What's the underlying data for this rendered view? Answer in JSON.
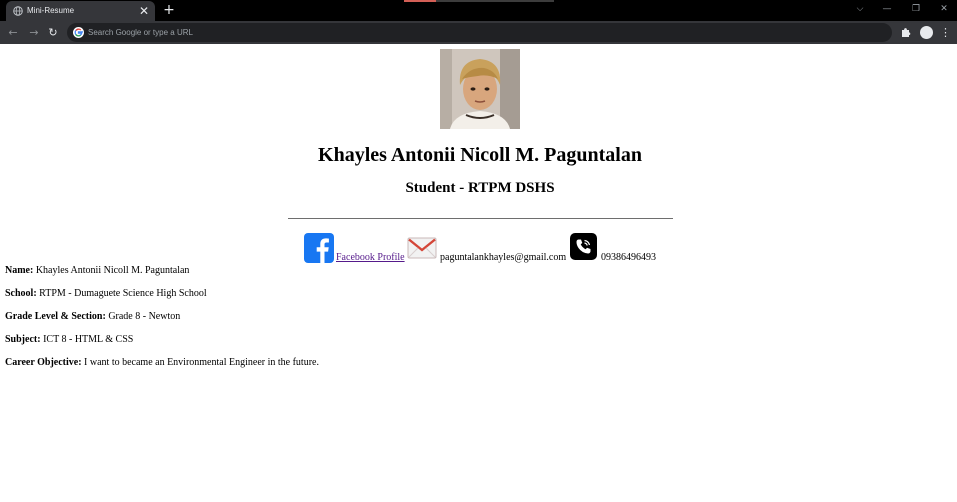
{
  "browser": {
    "tab_title": "Mini-Resume",
    "tab_close": "✕",
    "new_tab": "+",
    "omnibox_placeholder": "Search Google or type a URL",
    "window_controls": {
      "chevron": "⌵",
      "minimize": "—",
      "restore": "❐",
      "close": "✕"
    },
    "nav": {
      "back": "←",
      "forward": "→",
      "reload": "↻"
    },
    "menu": "⋮",
    "accent_color": "#d35f56"
  },
  "resume": {
    "name": "Khayles Antonii Nicoll M. Paguntalan",
    "role": "Student - RTPM DSHS",
    "contacts": {
      "facebook_label": "Facebook Profile",
      "email": "paguntalankhayles@gmail.com",
      "phone": "09386496493",
      "facebook_color": "#1877f2"
    },
    "details": [
      {
        "label": "Name:",
        "value": "Khayles Antonii Nicoll M. Paguntalan"
      },
      {
        "label": "School:",
        "value": "RTPM - Dumaguete Science High School"
      },
      {
        "label": "Grade Level & Section:",
        "value": "Grade 8 - Newton"
      },
      {
        "label": "Subject:",
        "value": "ICT 8 - HTML & CSS"
      },
      {
        "label": "Career Objective:",
        "value": "I want to became an Environmental Engineer in the future."
      }
    ]
  }
}
